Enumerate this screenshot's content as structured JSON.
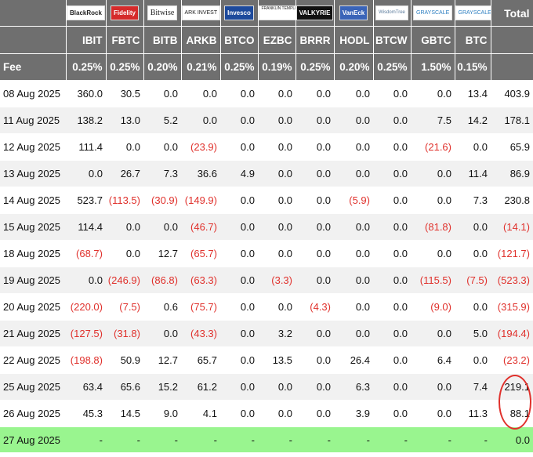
{
  "header": {
    "logos": [
      "BlackRock",
      "Fidelity",
      "Bitwise",
      "ARK INVEST",
      "Invesco",
      "FRANKLIN TEMPLETON",
      "VALKYRIE",
      "VanEck",
      "WisdomTree",
      "GRAYSCALE",
      "GRAYSCALE"
    ],
    "total_label": "Total",
    "tickers": [
      "IBIT",
      "FBTC",
      "BITB",
      "ARKB",
      "BTCO",
      "EZBC",
      "BRRR",
      "HODL",
      "BTCW",
      "GBTC",
      "BTC"
    ],
    "fee_label": "Fee",
    "fees": [
      "0.25%",
      "0.25%",
      "0.20%",
      "0.21%",
      "0.25%",
      "0.19%",
      "0.25%",
      "0.20%",
      "0.25%",
      "1.50%",
      "0.15%"
    ]
  },
  "rows": [
    {
      "date": "08 Aug 2025",
      "cells": [
        "360.0",
        "30.5",
        "0.0",
        "0.0",
        "0.0",
        "0.0",
        "0.0",
        "0.0",
        "0.0",
        "0.0",
        "13.4",
        "403.9"
      ]
    },
    {
      "date": "11 Aug 2025",
      "cells": [
        "138.2",
        "13.0",
        "5.2",
        "0.0",
        "0.0",
        "0.0",
        "0.0",
        "0.0",
        "0.0",
        "7.5",
        "14.2",
        "178.1"
      ]
    },
    {
      "date": "12 Aug 2025",
      "cells": [
        "111.4",
        "0.0",
        "0.0",
        "(23.9)",
        "0.0",
        "0.0",
        "0.0",
        "0.0",
        "0.0",
        "(21.6)",
        "0.0",
        "65.9"
      ]
    },
    {
      "date": "13 Aug 2025",
      "cells": [
        "0.0",
        "26.7",
        "7.3",
        "36.6",
        "4.9",
        "0.0",
        "0.0",
        "0.0",
        "0.0",
        "0.0",
        "11.4",
        "86.9"
      ]
    },
    {
      "date": "14 Aug 2025",
      "cells": [
        "523.7",
        "(113.5)",
        "(30.9)",
        "(149.9)",
        "0.0",
        "0.0",
        "0.0",
        "(5.9)",
        "0.0",
        "0.0",
        "7.3",
        "230.8"
      ]
    },
    {
      "date": "15 Aug 2025",
      "cells": [
        "114.4",
        "0.0",
        "0.0",
        "(46.7)",
        "0.0",
        "0.0",
        "0.0",
        "0.0",
        "0.0",
        "(81.8)",
        "0.0",
        "(14.1)"
      ]
    },
    {
      "date": "18 Aug 2025",
      "cells": [
        "(68.7)",
        "0.0",
        "12.7",
        "(65.7)",
        "0.0",
        "0.0",
        "0.0",
        "0.0",
        "0.0",
        "0.0",
        "0.0",
        "(121.7)"
      ]
    },
    {
      "date": "19 Aug 2025",
      "cells": [
        "0.0",
        "(246.9)",
        "(86.8)",
        "(63.3)",
        "0.0",
        "(3.3)",
        "0.0",
        "0.0",
        "0.0",
        "(115.5)",
        "(7.5)",
        "(523.3)"
      ]
    },
    {
      "date": "20 Aug 2025",
      "cells": [
        "(220.0)",
        "(7.5)",
        "0.6",
        "(75.7)",
        "0.0",
        "0.0",
        "(4.3)",
        "0.0",
        "0.0",
        "(9.0)",
        "0.0",
        "(315.9)"
      ]
    },
    {
      "date": "21 Aug 2025",
      "cells": [
        "(127.5)",
        "(31.8)",
        "0.0",
        "(43.3)",
        "0.0",
        "3.2",
        "0.0",
        "0.0",
        "0.0",
        "0.0",
        "5.0",
        "(194.4)"
      ]
    },
    {
      "date": "22 Aug 2025",
      "cells": [
        "(198.8)",
        "50.9",
        "12.7",
        "65.7",
        "0.0",
        "13.5",
        "0.0",
        "26.4",
        "0.0",
        "6.4",
        "0.0",
        "(23.2)"
      ]
    },
    {
      "date": "25 Aug 2025",
      "cells": [
        "63.4",
        "65.6",
        "15.2",
        "61.2",
        "0.0",
        "0.0",
        "0.0",
        "6.3",
        "0.0",
        "0.0",
        "7.4",
        "219.1"
      ]
    },
    {
      "date": "26 Aug 2025",
      "cells": [
        "45.3",
        "14.5",
        "9.0",
        "4.1",
        "0.0",
        "0.0",
        "0.0",
        "3.9",
        "0.0",
        "0.0",
        "11.3",
        "88.1"
      ]
    },
    {
      "date": "27 Aug 2025",
      "cells": [
        "-",
        "-",
        "-",
        "-",
        "-",
        "-",
        "-",
        "-",
        "-",
        "-",
        "-",
        "0.0"
      ]
    }
  ],
  "colors": {
    "header_bg": "#6f6f6f",
    "negative": "#e0312c",
    "highlight_row": "#99f58f",
    "stripe": "#f1f1f1",
    "annotation_circle": "#e0312c"
  }
}
